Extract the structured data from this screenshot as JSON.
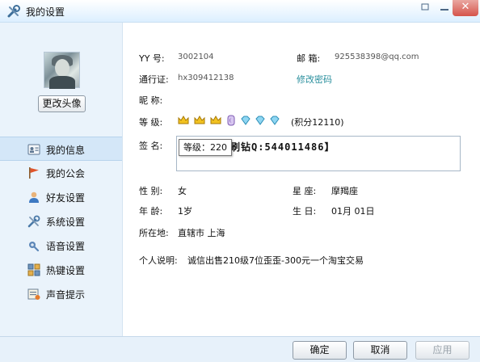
{
  "window": {
    "title": "我的设置",
    "controls": [
      "restore-icon",
      "minimize-icon",
      "close-icon"
    ],
    "close_glyph": "✕"
  },
  "sidebar": {
    "change_avatar_label": "更改头像",
    "items": [
      {
        "label": "我的信息",
        "icon": "profile-card-icon",
        "active": true
      },
      {
        "label": "我的公会",
        "icon": "flag-icon",
        "active": false
      },
      {
        "label": "好友设置",
        "icon": "user-icon",
        "active": false
      },
      {
        "label": "系统设置",
        "icon": "tools-icon",
        "active": false
      },
      {
        "label": "语音设置",
        "icon": "voice-icon",
        "active": false
      },
      {
        "label": "热键设置",
        "icon": "hotkey-icon",
        "active": false
      },
      {
        "label": "声音提示",
        "icon": "sound-icon",
        "active": false
      }
    ]
  },
  "profile": {
    "yy_label": "YY 号:",
    "yy_value": "3002104",
    "email_label": "邮  箱:",
    "email_value": "925538398@qq.com",
    "passport_label": "通行证:",
    "passport_value": "hx309412138",
    "change_password_label": "修改密码",
    "nickname_label": "昵  称:",
    "nickname_value": "",
    "level_label": "等  级:",
    "level_badges": [
      "crown-icon",
      "crown-icon",
      "crown-icon",
      "moon-icon",
      "diamond-icon",
      "diamond-icon",
      "diamond-icon"
    ],
    "points_text": "(积分12110)",
    "signature_label": "签  名:",
    "signature_value": "刷钻Q:544011486】",
    "tooltip_text": "等级：220",
    "gender_label": "性  别:",
    "gender_value": "女",
    "constellation_label": "星  座:",
    "constellation_value": "摩羯座",
    "age_label": "年  龄:",
    "age_value": "1岁",
    "birthday_label": "生  日:",
    "birthday_value": "01月  01日",
    "location_label": "所在地:",
    "location_value": "直辖市  上海",
    "bio_label": "个人说明:",
    "bio_value": "诚信出售210级7位歪歪-300元一个淘宝交易"
  },
  "footer": {
    "ok_label": "确定",
    "cancel_label": "取消",
    "apply_label": "应用"
  },
  "colors": {
    "link": "#2a8f9d",
    "sidebar_bg": "#eaf3fb",
    "active_item_bg": "#d4e7f8"
  }
}
